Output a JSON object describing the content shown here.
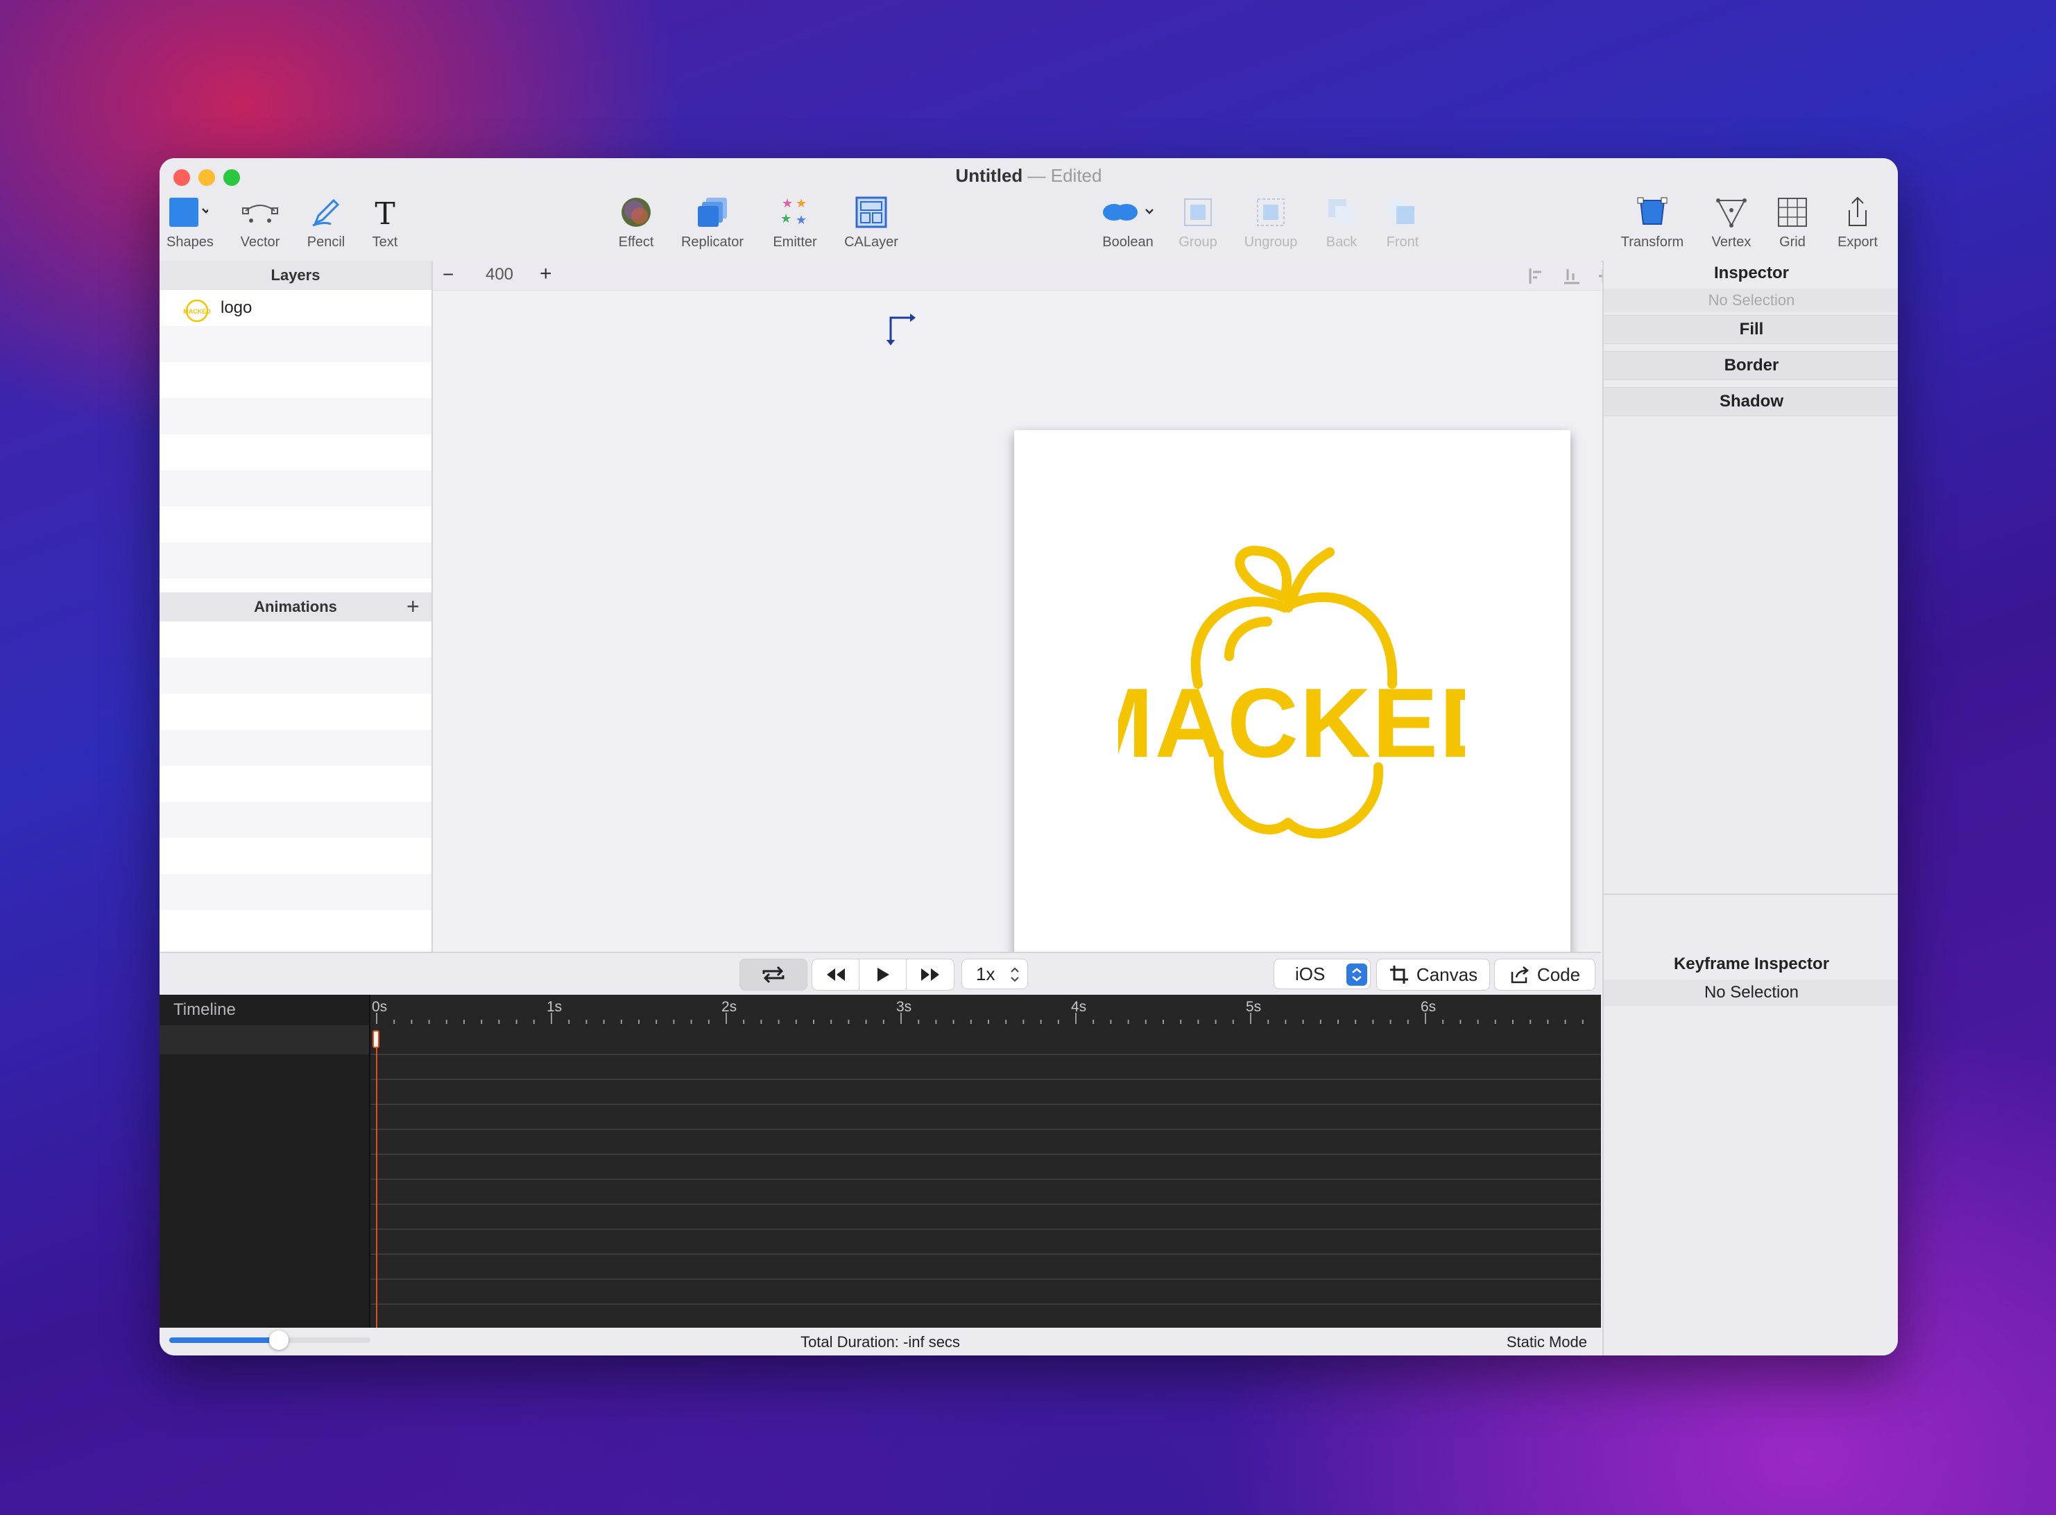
{
  "window": {
    "title": "Untitled",
    "edited": "— Edited"
  },
  "toolbar": {
    "shapes": "Shapes",
    "vector": "Vector",
    "pencil": "Pencil",
    "text": "Text",
    "effect": "Effect",
    "replicator": "Replicator",
    "emitter": "Emitter",
    "calayer": "CALayer",
    "boolean": "Boolean",
    "group": "Group",
    "ungroup": "Ungroup",
    "back": "Back",
    "front": "Front",
    "transform": "Transform",
    "vertex": "Vertex",
    "grid": "Grid",
    "export": "Export"
  },
  "layers": {
    "heading": "Layers",
    "items": [
      {
        "name": "logo"
      }
    ]
  },
  "animations": {
    "heading": "Animations",
    "add": "+"
  },
  "zoom": {
    "minus": "−",
    "value": "400",
    "plus": "+"
  },
  "canvas": {
    "logo_text": "MACKED",
    "logo_color": "#f5c400"
  },
  "inspector": {
    "heading": "Inspector",
    "selection": "No Selection",
    "sections": [
      "Fill",
      "Border",
      "Shadow"
    ],
    "keyframe_heading": "Keyframe Inspector",
    "keyframe_selection": "No Selection"
  },
  "playback": {
    "speed": "1x",
    "platform": "iOS",
    "canvas_btn": "Canvas",
    "code_btn": "Code"
  },
  "timeline": {
    "label": "Timeline",
    "ticks": [
      "0s",
      "1s",
      "2s",
      "3s",
      "4s",
      "5s",
      "6s"
    ]
  },
  "status": {
    "duration": "Total Duration: -inf secs",
    "mode": "Static Mode"
  }
}
